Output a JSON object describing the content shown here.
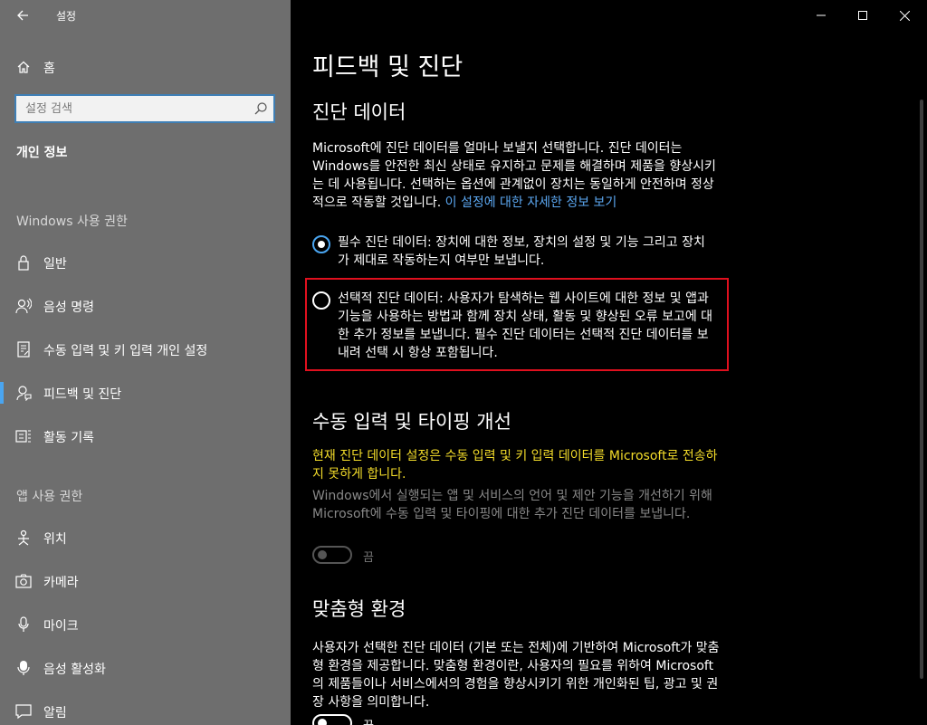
{
  "window": {
    "app_title": "설정",
    "controls": {
      "minimize": "minimize",
      "maximize": "maximize",
      "close": "close"
    }
  },
  "sidebar": {
    "home_label": "홈",
    "search": {
      "placeholder": "설정 검색"
    },
    "category": "개인 정보",
    "groups": [
      {
        "title": "Windows 사용 권한",
        "items": [
          {
            "label": "일반",
            "icon": "lock-icon"
          },
          {
            "label": "음성 명령",
            "icon": "speech-icon"
          },
          {
            "label": "수동 입력 및 키 입력 개인 설정",
            "icon": "document-pen-icon"
          },
          {
            "label": "피드백 및 진단",
            "icon": "feedback-icon",
            "selected": true
          },
          {
            "label": "활동 기록",
            "icon": "activity-icon"
          }
        ]
      },
      {
        "title": "앱 사용 권한",
        "items": [
          {
            "label": "위치",
            "icon": "location-icon"
          },
          {
            "label": "카메라",
            "icon": "camera-icon"
          },
          {
            "label": "마이크",
            "icon": "microphone-icon"
          },
          {
            "label": "음성 활성화",
            "icon": "voice-activation-icon"
          },
          {
            "label": "알림",
            "icon": "notification-icon"
          }
        ]
      }
    ]
  },
  "main": {
    "title": "피드백 및 진단",
    "diagnostic": {
      "heading": "진단 데이터",
      "description": "Microsoft에 진단 데이터를 얼마나 보낼지 선택합니다. 진단 데이터는 Windows를 안전한 최신 상태로 유지하고 문제를 해결하며 제품을 향상시키는 데 사용됩니다. 선택하는 옵션에 관계없이 장치는 동일하게 안전하며 정상적으로 작동할 것입니다.",
      "link": "이 설정에 대한 자세한 정보 보기",
      "options": [
        {
          "label": "필수 진단 데이터: 장치에 대한 정보, 장치의 설정 및 기능 그리고 장치가 제대로 작동하는지 여부만 보냅니다.",
          "checked": true
        },
        {
          "label": "선택적 진단 데이터: 사용자가 탐색하는 웹 사이트에 대한 정보 및 앱과 기능을 사용하는 방법과 함께 장치 상태, 활동 및 향상된 오류 보고에 대한 추가 정보를 보냅니다. 필수 진단 데이터는 선택적 진단 데이터를 보내려 선택 시 항상 포함됩니다.",
          "checked": false
        }
      ]
    },
    "inking": {
      "heading": "수동 입력 및 타이핑 개선",
      "warning": "현재 진단 데이터 설정은 수동 입력 및 키 입력 데이터를 Microsoft로 전송하지 못하게 합니다.",
      "description": "Windows에서 실행되는 앱 및 서비스의 언어 및 제안 기능을 개선하기 위해 Microsoft에 수동 입력 및 타이핑에 대한 추가 진단 데이터를 보냅니다.",
      "toggle_label": "끔",
      "toggle_on": false
    },
    "tailored": {
      "heading": "맞춤형 환경",
      "description": "사용자가 선택한 진단 데이터 (기본 또는 전체)에 기반하여 Microsoft가 맞춤형 환경을 제공합니다. 맞춤형 환경이란, 사용자의 필요를 위하여 Microsoft의 제품들이나 서비스에서의 경험을 향상시키기 위한 개인화된 팁, 광고 및 권장 사항을 의미합니다.",
      "toggle_label": "끔",
      "toggle_on": false
    }
  }
}
